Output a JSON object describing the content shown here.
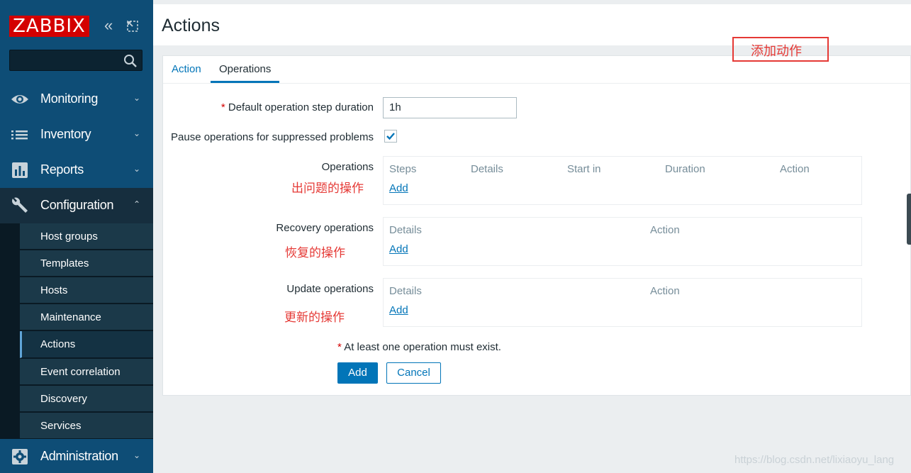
{
  "sidebar": {
    "logo": "ZABBIX",
    "collapse_glyph": "«",
    "menu": [
      {
        "label": "Monitoring",
        "icon": "eye-icon"
      },
      {
        "label": "Inventory",
        "icon": "list-icon"
      },
      {
        "label": "Reports",
        "icon": "bar-chart-icon"
      },
      {
        "label": "Configuration",
        "icon": "wrench-icon"
      },
      {
        "label": "Administration",
        "icon": "gear-icon"
      }
    ],
    "chev_down": "⌄",
    "chev_up": "⌃",
    "submenu": [
      "Host groups",
      "Templates",
      "Hosts",
      "Maintenance",
      "Actions",
      "Event correlation",
      "Discovery",
      "Services"
    ]
  },
  "header": {
    "title": "Actions"
  },
  "annotation": {
    "top": "添加动作"
  },
  "tabs": {
    "action": "Action",
    "operations": "Operations"
  },
  "form": {
    "req_mark": "*",
    "step_duration_label": "Default operation step duration",
    "step_duration_value": "1h",
    "pause_label": "Pause operations for suppressed problems",
    "pause_checked": true,
    "operations_label": "Operations",
    "operations_note": "出问题的操作",
    "operations_cols": [
      "Steps",
      "Details",
      "Start in",
      "Duration",
      "Action"
    ],
    "recovery_label": "Recovery operations",
    "recovery_note": "恢复的操作",
    "recovery_cols": [
      "Details",
      "Action"
    ],
    "update_label": "Update operations",
    "update_note": "更新的操作",
    "update_cols": [
      "Details",
      "Action"
    ],
    "add_link": "Add",
    "hint": "At least one operation must exist.",
    "add_button": "Add",
    "cancel_button": "Cancel"
  },
  "watermark": "https://blog.csdn.net/lixiaoyu_lang",
  "colors": {
    "brand_red": "#d40000",
    "link_blue": "#0275b8",
    "sidebar_blue": "#0e4d76",
    "annotation_red": "#e53935"
  }
}
